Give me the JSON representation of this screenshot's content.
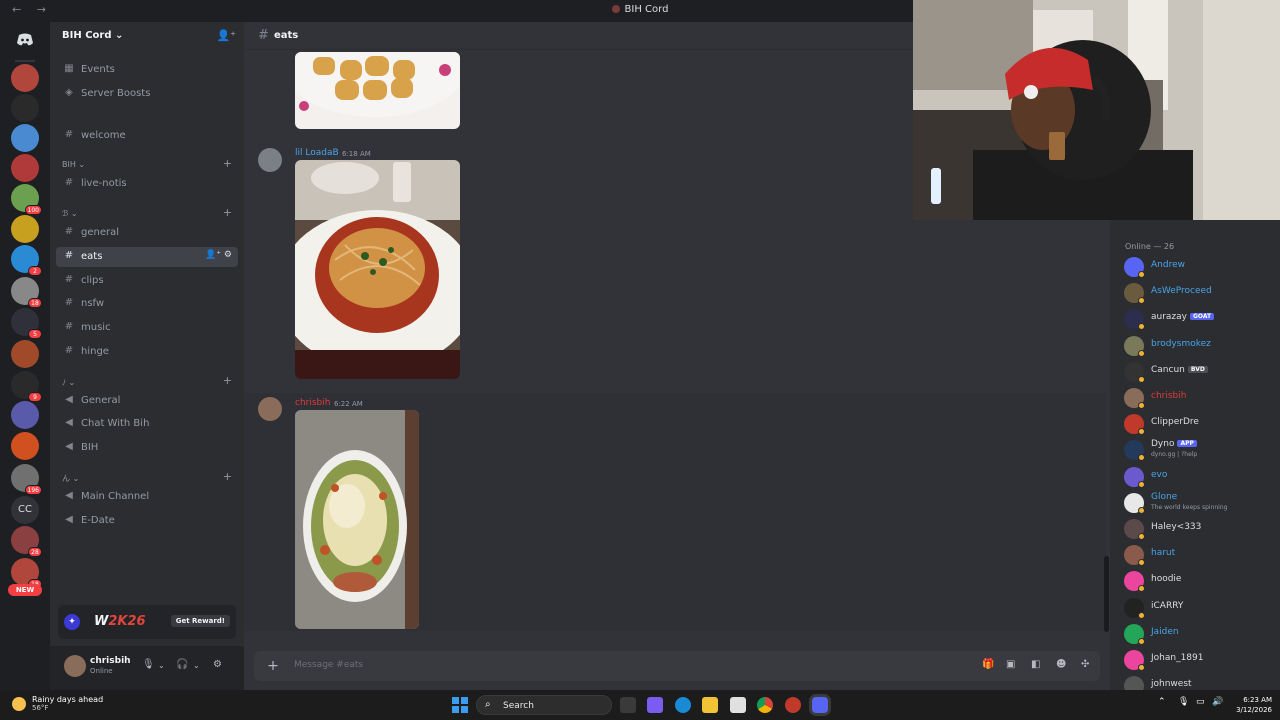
{
  "window": {
    "title": "BIH Cord"
  },
  "server_rail": {
    "badges": [
      "100",
      "2",
      "18",
      "5",
      "9",
      "196",
      "28",
      "18"
    ],
    "cc_label": "CC",
    "new_label": "NEW"
  },
  "sidebar": {
    "guild_name": "BIH Cord",
    "top_items": [
      "Events",
      "Server Boosts"
    ],
    "welcome_channel": "welcome",
    "categories": [
      {
        "name": "BIH",
        "channels": [
          "live-notis"
        ]
      },
      {
        "name": "ℬ",
        "channels": [
          "general",
          "eats",
          "clips",
          "nsfw",
          "music",
          "hinge"
        ]
      },
      {
        "name": "ﾉ",
        "channels": [
          "General",
          "Chat With Bih",
          "BIH"
        ]
      },
      {
        "name": "ん",
        "channels": [
          "Main Channel",
          "E-Date"
        ]
      }
    ],
    "active_channel": "eats",
    "promo": {
      "game_w": "W",
      "game_num": "2K26",
      "button": "Get Reward!"
    },
    "user": {
      "name": "chrisbih",
      "status": "Online"
    }
  },
  "chat": {
    "channel_name": "eats",
    "messages": [
      {
        "author": "lil LoadaB",
        "time": "6:18 AM",
        "author_color": "#4aa3e8"
      },
      {
        "author": "chrisbih",
        "time": "6:22 AM",
        "author_color": "#e03b3b"
      }
    ],
    "composer_placeholder": "Message #eats"
  },
  "members": {
    "header": "Online — 26",
    "list": [
      {
        "name": "Andrew",
        "color": "#4aa3e8",
        "avatar": "#5865f2"
      },
      {
        "name": "AsWeProceed",
        "color": "#4aa3e8",
        "avatar": "#6b5b3e"
      },
      {
        "name": "aurazay",
        "color": "#dbdee1",
        "avatar": "#2d2d4d",
        "tag": "GOAT",
        "tag_color": "#5865f2"
      },
      {
        "name": "brodysmokez",
        "color": "#4aa3e8",
        "avatar": "#7a7a5a"
      },
      {
        "name": "Cancun",
        "color": "#dbdee1",
        "avatar": "#333",
        "tag": "BVD",
        "tag_color": "#4e5058"
      },
      {
        "name": "chrisbih",
        "color": "#e03b3b",
        "avatar": "#8a6c5a"
      },
      {
        "name": "ClipperDre",
        "color": "#dbdee1",
        "avatar": "#c0392b"
      },
      {
        "name": "Dyno",
        "color": "#dbdee1",
        "avatar": "#243a5a",
        "tag": "APP",
        "tag_color": "#5865f2",
        "sub": "dyno.gg | ?help"
      },
      {
        "name": "evo",
        "color": "#4aa3e8",
        "avatar": "#6a5acd"
      },
      {
        "name": "Glone",
        "color": "#4aa3e8",
        "avatar": "#e8e8e8",
        "sub": "The world keeps spinning"
      },
      {
        "name": "Haley<333",
        "color": "#dbdee1",
        "avatar": "#5a4a4a"
      },
      {
        "name": "harut",
        "color": "#4aa3e8",
        "avatar": "#8a5a4a"
      },
      {
        "name": "hoodie",
        "color": "#dbdee1",
        "avatar": "#eb459e"
      },
      {
        "name": "iCARRY",
        "color": "#dbdee1",
        "avatar": "#222"
      },
      {
        "name": "Jaiden",
        "color": "#4aa3e8",
        "avatar": "#23a55a"
      },
      {
        "name": "Johan_1891",
        "color": "#dbdee1",
        "avatar": "#eb459e"
      },
      {
        "name": "johnwest",
        "color": "#dbdee1",
        "avatar": "#555"
      }
    ]
  },
  "taskbar": {
    "weather_title": "Rainy days ahead",
    "weather_temp": "56°F",
    "search_label": "Search",
    "time": "6:23 AM",
    "date": "3/12/2026"
  }
}
